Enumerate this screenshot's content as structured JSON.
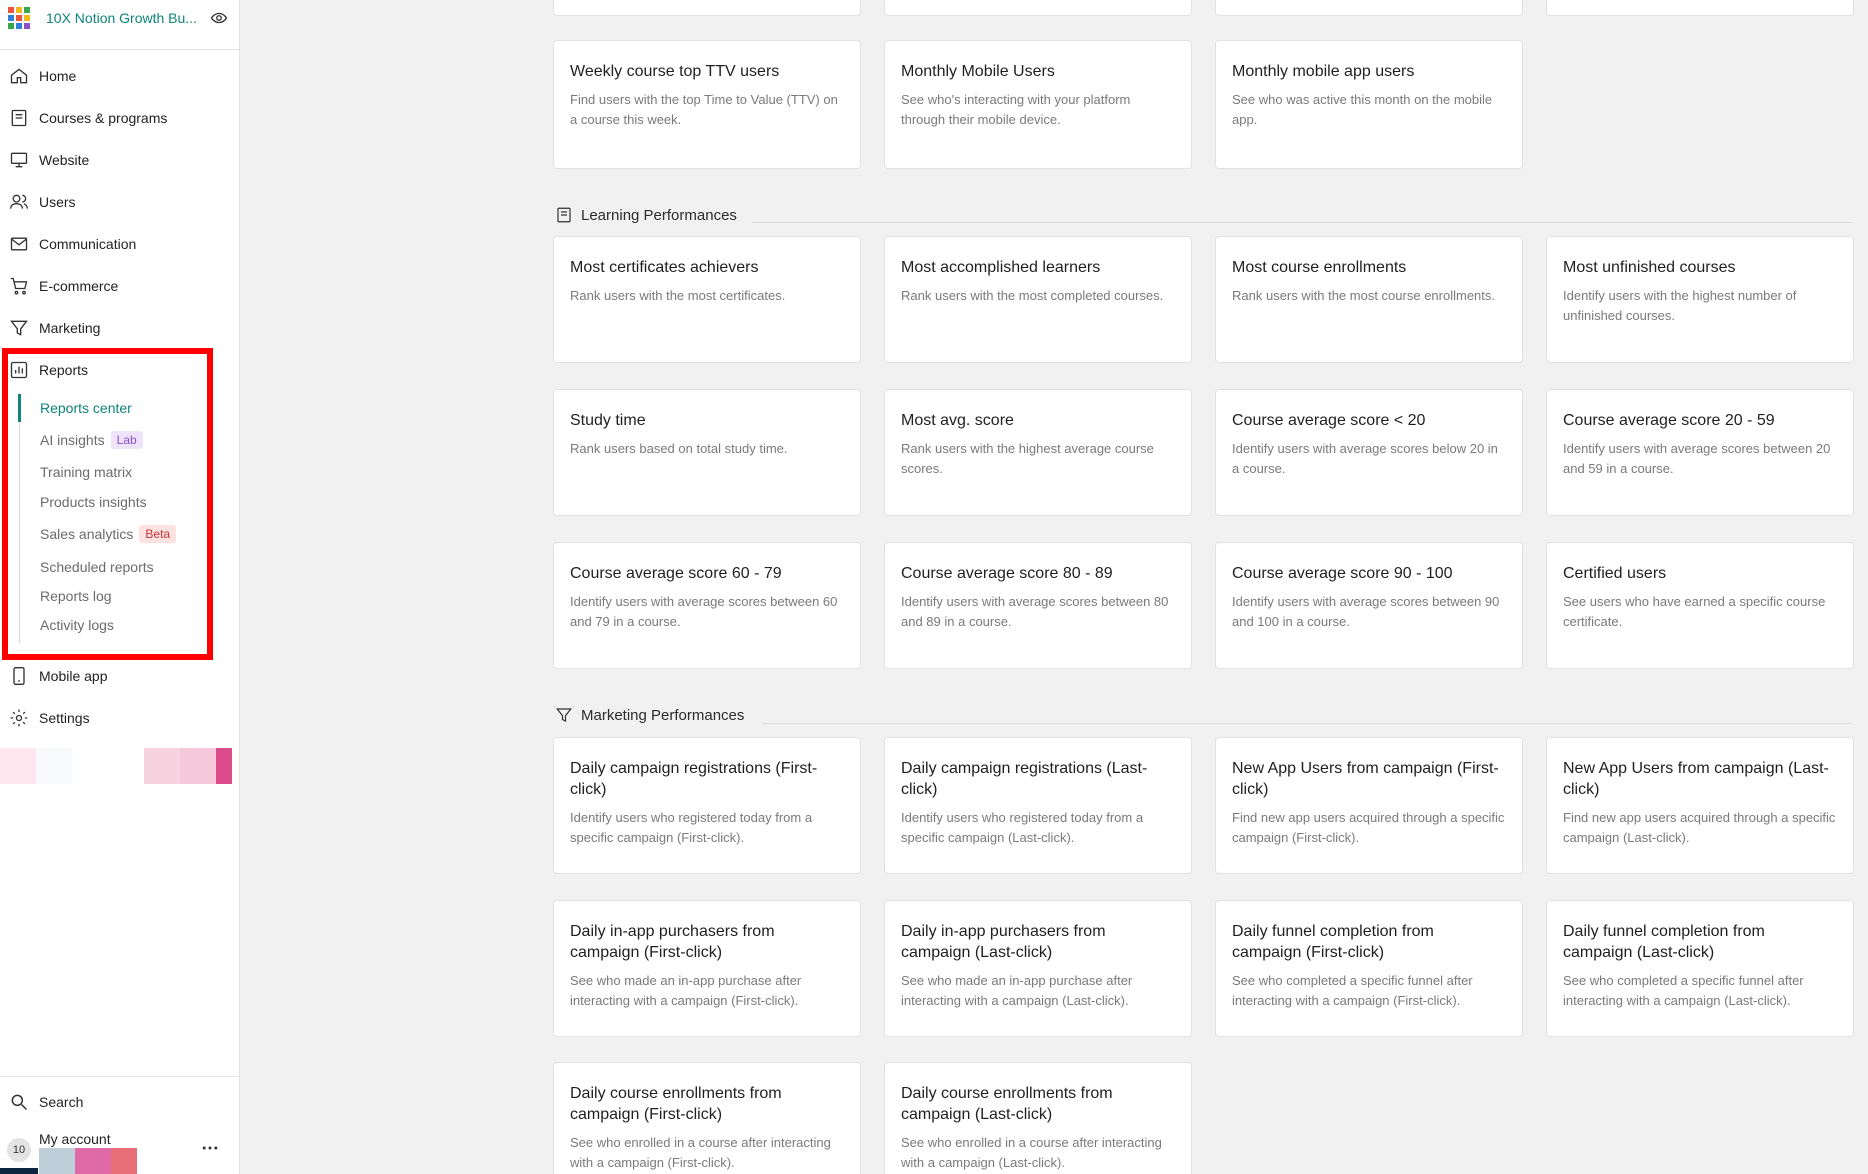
{
  "brand": {
    "name": "10X Notion Growth Bu...",
    "grid_colors": [
      "#e8543d",
      "#f2b81d",
      "#3aa64a",
      "#2f7fdc",
      "#e8543d",
      "#f2b81d",
      "#3aa64a",
      "#2f7fdc",
      "#8a4fc9"
    ]
  },
  "sidebar": {
    "items": [
      {
        "label": "Home",
        "icon": "home-icon"
      },
      {
        "label": "Courses & programs",
        "icon": "book-icon"
      },
      {
        "label": "Website",
        "icon": "monitor-icon"
      },
      {
        "label": "Users",
        "icon": "users-icon"
      },
      {
        "label": "Communication",
        "icon": "mail-icon"
      },
      {
        "label": "E-commerce",
        "icon": "cart-icon"
      },
      {
        "label": "Marketing",
        "icon": "funnel-icon"
      },
      {
        "label": "Reports",
        "icon": "chart-icon"
      }
    ],
    "reports_sub": [
      {
        "label": "Reports center",
        "tag": ""
      },
      {
        "label": "AI insights",
        "tag": "Lab"
      },
      {
        "label": "Training matrix",
        "tag": ""
      },
      {
        "label": "Products insights",
        "tag": ""
      },
      {
        "label": "Sales analytics",
        "tag": "Beta"
      },
      {
        "label": "Scheduled reports",
        "tag": ""
      },
      {
        "label": "Reports log",
        "tag": ""
      },
      {
        "label": "Activity logs",
        "tag": ""
      }
    ],
    "after_items": [
      {
        "label": "Mobile app",
        "icon": "phone-icon"
      },
      {
        "label": "Settings",
        "icon": "gear-icon"
      }
    ],
    "swatch_colors": [
      "#fde8ef",
      "#f8fafc",
      "#f7d3e0",
      "#f5c8da",
      "#dc4b8a"
    ],
    "search_label": "Search",
    "account_label": "My account",
    "avatar_text": "10",
    "account_colors": [
      "#bfcfd9",
      "#df6aa6",
      "#e86f78"
    ]
  },
  "main": {
    "top_row": [
      {
        "title": "Weekly course top TTV users",
        "desc": "Find users with the top Time to Value (TTV) on a course this week."
      },
      {
        "title": "Monthly Mobile Users",
        "desc": "See who's interacting with your platform through their mobile device."
      },
      {
        "title": "Monthly mobile app users",
        "desc": "See who was active this month on the mobile app."
      }
    ],
    "learning": {
      "title": "Learning Performances",
      "cards": [
        {
          "title": "Most certificates achievers",
          "desc": "Rank users with the most certificates."
        },
        {
          "title": "Most accomplished learners",
          "desc": "Rank users with the most completed courses."
        },
        {
          "title": "Most course enrollments",
          "desc": "Rank users with the most course enrollments."
        },
        {
          "title": "Most unfinished courses",
          "desc": "Identify users with the highest number of unfinished courses."
        },
        {
          "title": "Study time",
          "desc": "Rank users based on total study time."
        },
        {
          "title": "Most avg. score",
          "desc": "Rank users with the highest average course scores."
        },
        {
          "title": "Course average score < 20",
          "desc": "Identify users with average scores below 20 in a course."
        },
        {
          "title": "Course average score 20 - 59",
          "desc": "Identify users with average scores between 20 and 59 in a course."
        },
        {
          "title": "Course average score 60 - 79",
          "desc": "Identify users with average scores between 60 and 79 in a course."
        },
        {
          "title": "Course average score 80 - 89",
          "desc": "Identify users with average scores between 80 and 89 in a course."
        },
        {
          "title": "Course average score 90 - 100",
          "desc": "Identify users with average scores between 90 and 100 in a course."
        },
        {
          "title": "Certified users",
          "desc": "See users who have earned a specific course certificate."
        }
      ]
    },
    "marketing": {
      "title": "Marketing Performances",
      "cards": [
        {
          "title": "Daily campaign registrations (First-click)",
          "desc": "Identify users who registered today from a specific campaign (First-click)."
        },
        {
          "title": "Daily campaign registrations (Last-click)",
          "desc": "Identify users who registered today from a specific campaign (Last-click)."
        },
        {
          "title": "New App Users from campaign (First-click)",
          "desc": "Find new app users acquired through a specific campaign (First-click)."
        },
        {
          "title": "New App Users from campaign (Last-click)",
          "desc": "Find new app users acquired through a specific campaign (Last-click)."
        },
        {
          "title": "Daily in-app purchasers from campaign (First-click)",
          "desc": "See who made an in-app purchase after interacting with a campaign (First-click)."
        },
        {
          "title": "Daily in-app purchasers from campaign (Last-click)",
          "desc": "See who made an in-app purchase after interacting with a campaign (Last-click)."
        },
        {
          "title": "Daily funnel completion from campaign (First-click)",
          "desc": "See who completed a specific funnel after interacting with a campaign (First-click)."
        },
        {
          "title": "Daily funnel completion from campaign (Last-click)",
          "desc": "See who completed a specific funnel after interacting with a campaign (Last-click)."
        },
        {
          "title": "Daily course enrollments from campaign (First-click)",
          "desc": "See who enrolled in a course after interacting with a campaign (First-click)."
        },
        {
          "title": "Daily course enrollments from campaign (Last-click)",
          "desc": "See who enrolled in a course after interacting with a campaign (Last-click)."
        }
      ]
    }
  }
}
